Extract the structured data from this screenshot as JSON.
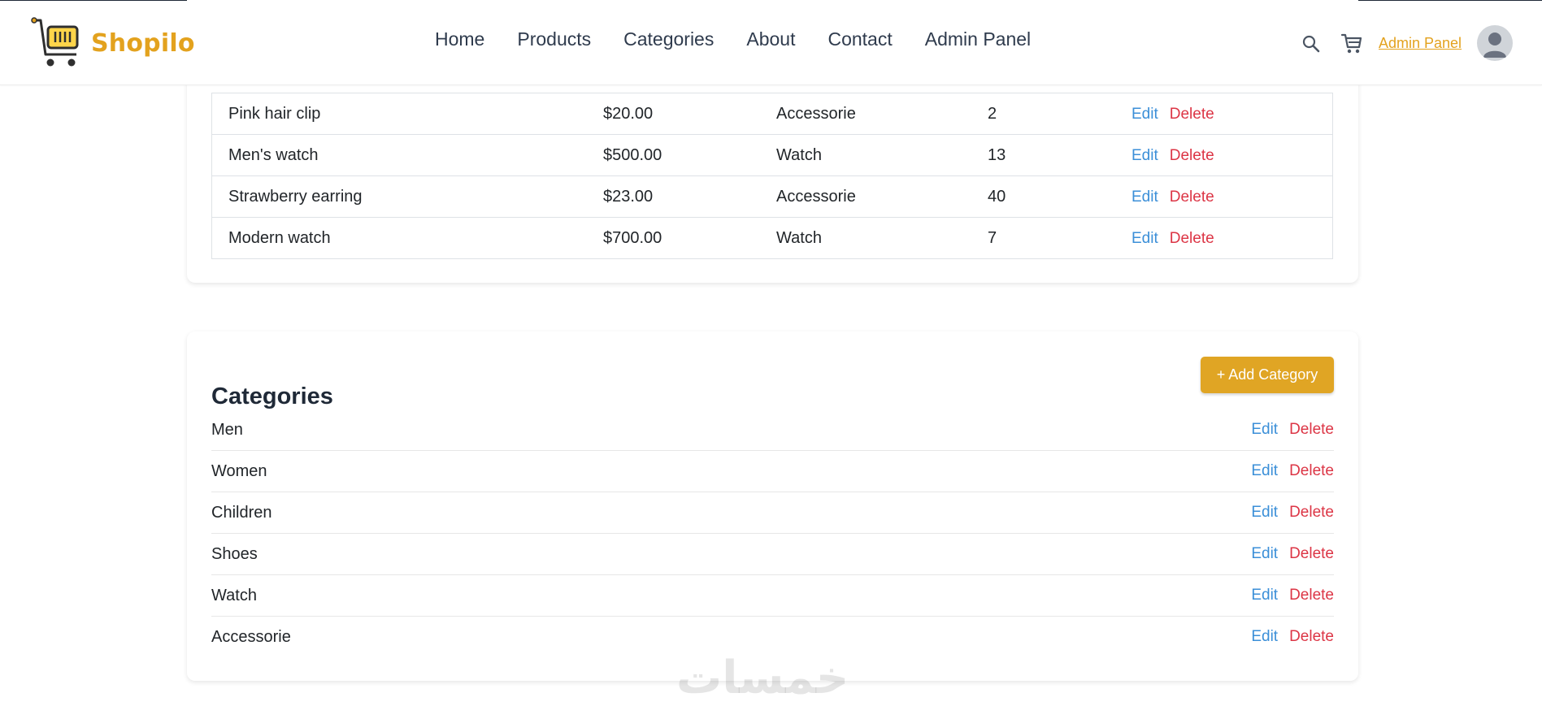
{
  "brand": {
    "name": "Shopilo"
  },
  "nav": [
    {
      "label": "Home"
    },
    {
      "label": "Products"
    },
    {
      "label": "Categories"
    },
    {
      "label": "About"
    },
    {
      "label": "Contact"
    },
    {
      "label": "Admin Panel"
    }
  ],
  "header": {
    "admin_link": "Admin Panel"
  },
  "products": {
    "rows": [
      {
        "name": "Pink hair clip",
        "price": "$20.00",
        "category": "Accessorie",
        "stock": "2",
        "edit": "Edit",
        "delete": "Delete"
      },
      {
        "name": "Men's watch",
        "price": "$500.00",
        "category": "Watch",
        "stock": "13",
        "edit": "Edit",
        "delete": "Delete"
      },
      {
        "name": "Strawberry earring",
        "price": "$23.00",
        "category": "Accessorie",
        "stock": "40",
        "edit": "Edit",
        "delete": "Delete"
      },
      {
        "name": "Modern watch",
        "price": "$700.00",
        "category": "Watch",
        "stock": "7",
        "edit": "Edit",
        "delete": "Delete"
      }
    ]
  },
  "categories": {
    "title": "Categories",
    "add_button": "+ Add Category",
    "items": [
      {
        "name": "Men",
        "edit": "Edit",
        "delete": "Delete"
      },
      {
        "name": "Women",
        "edit": "Edit",
        "delete": "Delete"
      },
      {
        "name": "Children",
        "edit": "Edit",
        "delete": "Delete"
      },
      {
        "name": "Shoes",
        "edit": "Edit",
        "delete": "Delete"
      },
      {
        "name": "Watch",
        "edit": "Edit",
        "delete": "Delete"
      },
      {
        "name": "Accessorie",
        "edit": "Edit",
        "delete": "Delete"
      }
    ]
  },
  "watermark": "خمسات",
  "colors": {
    "accent": "#e3a21e",
    "link": "#3b8fd8",
    "danger": "#dc3545"
  },
  "icons": {
    "search": "search-icon",
    "cart": "cart-icon",
    "avatar": "user-avatar-icon",
    "logo": "shopping-cart-logo-icon"
  }
}
